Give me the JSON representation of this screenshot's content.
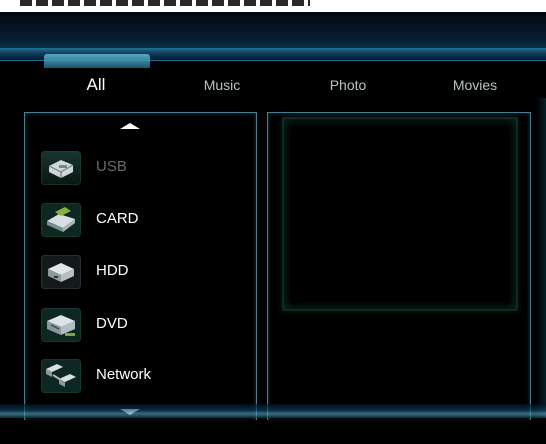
{
  "tabs": {
    "all": "All",
    "music": "Music",
    "photo": "Photo",
    "movies": "Movies"
  },
  "devices": {
    "usb": {
      "label": "USB",
      "icon": "usb-drive-icon",
      "state": "disabled"
    },
    "card": {
      "label": "CARD",
      "icon": "card-reader-icon",
      "state": "enabled"
    },
    "hdd": {
      "label": "HDD",
      "icon": "hard-drive-icon",
      "state": "enabled"
    },
    "dvd": {
      "label": "DVD",
      "icon": "dvd-drive-icon",
      "state": "enabled"
    },
    "network": {
      "label": "Network",
      "icon": "network-icon",
      "state": "enabled"
    }
  },
  "colors": {
    "accent": "#2f8db1",
    "panel_border": "#4a7f92",
    "text_active": "#ffffff",
    "text_inactive": "#b9c4c9",
    "text_disabled": "#666c70",
    "preview_border": "#0b2a24"
  }
}
